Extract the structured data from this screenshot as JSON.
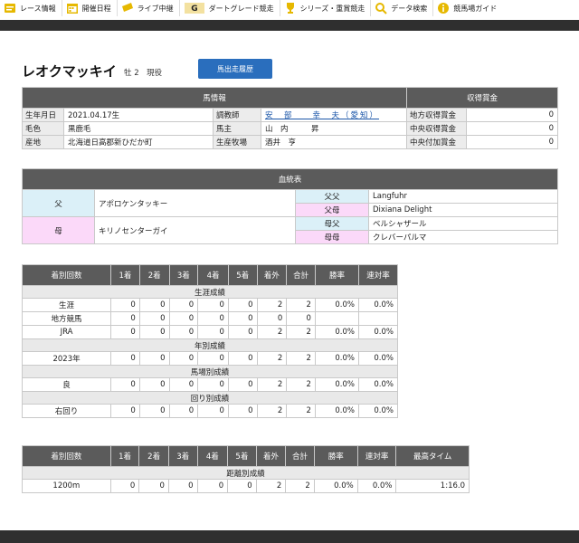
{
  "nav": [
    {
      "label": "レース情報",
      "icon": "race-info-icon"
    },
    {
      "label": "開催日程",
      "icon": "calendar-icon"
    },
    {
      "label": "ライブ中継",
      "icon": "ticket-icon"
    },
    {
      "label": "ダートグレード競走",
      "icon": "dirt-grade-logo-icon"
    },
    {
      "label": "シリーズ・重賞競走",
      "icon": "trophy-icon"
    },
    {
      "label": "データ検索",
      "icon": "search-icon"
    },
    {
      "label": "競馬場ガイド",
      "icon": "info-icon"
    }
  ],
  "horse": {
    "name": "レオクマッキイ",
    "sub": "牡 2　現役",
    "history_btn": "馬出走履歴"
  },
  "info": {
    "header": "馬情報",
    "prize_header": "収得賞金",
    "birth_label": "生年月日",
    "birth": "2021.04.17生",
    "trainer_label": "調教師",
    "trainer": "安　部　　幸　夫（愛知）",
    "coat_label": "毛色",
    "coat": "黒鹿毛",
    "owner_label": "馬主",
    "owner": "山　内　　　昇",
    "origin_label": "産地",
    "origin": "北海道日高郡新ひだか町",
    "breeder_label": "生産牧場",
    "breeder": "酒井　亨",
    "prize": [
      {
        "label": "地方収得賞金",
        "value": "0"
      },
      {
        "label": "中央収得賞金",
        "value": "0"
      },
      {
        "label": "中央付加賞金",
        "value": "0"
      }
    ]
  },
  "pedigree": {
    "header": "血統表",
    "father_label": "父",
    "father": "アポロケンタッキー",
    "mother_label": "母",
    "mother": "キリノセンターガイ",
    "ff_label": "父父",
    "ff": "Langfuhr",
    "fm_label": "父母",
    "fm": "Dixiana Delight",
    "mf_label": "母父",
    "mf": "ベルシャザール",
    "mm_label": "母母",
    "mm": "クレバーパルマ"
  },
  "stats": {
    "headers": [
      "着別回数",
      "1着",
      "2着",
      "3着",
      "4着",
      "5着",
      "着外",
      "合計",
      "勝率",
      "連対率"
    ],
    "sec_career": "生涯成績",
    "career": [
      [
        "生涯",
        "0",
        "0",
        "0",
        "0",
        "0",
        "2",
        "2",
        "0.0%",
        "0.0%"
      ],
      [
        "地方競馬",
        "0",
        "0",
        "0",
        "0",
        "0",
        "0",
        "0",
        "",
        ""
      ],
      [
        "JRA",
        "0",
        "0",
        "0",
        "0",
        "0",
        "2",
        "2",
        "0.0%",
        "0.0%"
      ]
    ],
    "sec_year": "年別成績",
    "year": [
      [
        "2023年",
        "0",
        "0",
        "0",
        "0",
        "0",
        "2",
        "2",
        "0.0%",
        "0.0%"
      ]
    ],
    "sec_track": "馬場別成績",
    "track": [
      [
        "良",
        "0",
        "0",
        "0",
        "0",
        "0",
        "2",
        "2",
        "0.0%",
        "0.0%"
      ]
    ],
    "sec_turn": "回り別成績",
    "turn": [
      [
        "右回り",
        "0",
        "0",
        "0",
        "0",
        "0",
        "2",
        "2",
        "0.0%",
        "0.0%"
      ]
    ]
  },
  "distance": {
    "headers": [
      "着別回数",
      "1着",
      "2着",
      "3着",
      "4着",
      "5着",
      "着外",
      "合計",
      "勝率",
      "連対率",
      "最高タイム"
    ],
    "sec": "距離別成績",
    "rows": [
      [
        "1200m",
        "0",
        "0",
        "0",
        "0",
        "0",
        "2",
        "2",
        "0.0%",
        "0.0%",
        "1:16.0"
      ]
    ]
  },
  "colors": {
    "accent": "#2a6ebd",
    "header": "#5b5b5b",
    "father": "#dbf0f8",
    "mother": "#fbd9f9"
  }
}
